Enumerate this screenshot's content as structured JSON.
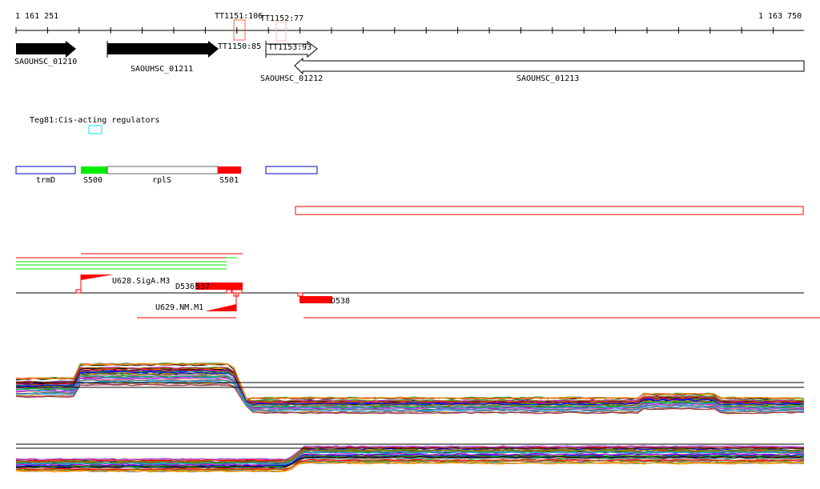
{
  "ruler": {
    "start": "1 161 251",
    "end": "1 163 750"
  },
  "terminators": [
    "TT1151:106",
    "TT1152:77",
    "TT1150:85",
    "TT1153:93"
  ],
  "genes": [
    "SAOUHSC_01210",
    "SAOUHSC_01211",
    "SAOUHSC_01212",
    "SAOUHSC_01213"
  ],
  "regulator": "Teg81:Cis-acting regulators",
  "features": [
    "trmD",
    "S500",
    "rplS",
    "S501"
  ],
  "elements": {
    "u628": "U628.SigA.M3",
    "d536": "D536",
    "d537": "537",
    "u629": "U629.NM.M1",
    "d538": "D538"
  },
  "colors": {
    "red": "#ff0000",
    "green": "#00ee00",
    "blue": "#0000cc",
    "cyan": "#00e5ff"
  }
}
